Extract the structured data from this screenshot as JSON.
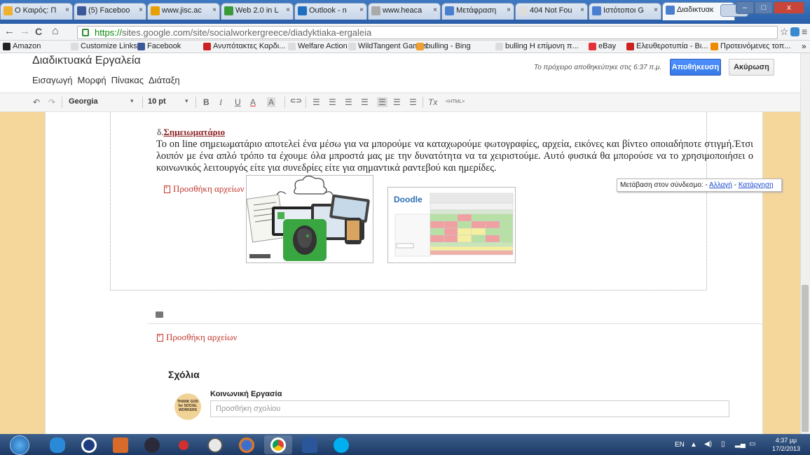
{
  "browser": {
    "tabs": [
      {
        "label": "Ο Καιρός: Π",
        "favicon_color": "#f0b030"
      },
      {
        "label": "(5) Faceboo",
        "favicon_color": "#3b5998"
      },
      {
        "label": "www.jisc.ac",
        "favicon_color": "#e7a000"
      },
      {
        "label": "Web 2.0 in L",
        "favicon_color": "#3a9a3a"
      },
      {
        "label": "Outlook - n",
        "favicon_color": "#1e6fc0"
      },
      {
        "label": "www.heaca",
        "favicon_color": "#aaaaaa"
      },
      {
        "label": "Μετάφραση",
        "favicon_color": "#4a7fd0"
      },
      {
        "label": "404 Not Fou",
        "favicon_color": "#dddddd"
      },
      {
        "label": "Ιστότοποι G",
        "favicon_color": "#4a7fd0"
      },
      {
        "label": "Διαδικτυακ",
        "favicon_color": "#4a7fd0",
        "active": true
      }
    ],
    "tab_close": "×",
    "window_controls": {
      "minimize": "–",
      "maximize": "□",
      "close": "x"
    },
    "url_scheme": "https://",
    "url_rest": "sites.google.com/site/socialworkergreece/diadyktiaka-ergaleia",
    "nav": {
      "back": "←",
      "forward": "→",
      "reload": "C",
      "home": "⌂",
      "star": "☆",
      "menu": "≡"
    },
    "bookmarks": [
      {
        "label": "Amazon",
        "color": "#222222"
      },
      {
        "label": "Customize Links",
        "color": "#dddddd"
      },
      {
        "label": "Facebook",
        "color": "#3b5998"
      },
      {
        "label": "Ανυπότακτες Καρδι...",
        "color": "#cc2222"
      },
      {
        "label": "Welfare Action",
        "color": "#dddddd"
      },
      {
        "label": "WildTangent Games",
        "color": "#dddddd"
      },
      {
        "label": "bulling - Bing",
        "color": "#f0a030"
      },
      {
        "label": "bulling Η επίμονη π...",
        "color": "#dddddd"
      },
      {
        "label": "eBay",
        "color": "#e53238"
      },
      {
        "label": "Ελευθεροτυπία - Βι...",
        "color": "#cc2222"
      },
      {
        "label": "Προτεινόμενες τοπ...",
        "color": "#f08a00"
      }
    ],
    "bookmarks_more": "»"
  },
  "site": {
    "title": "Διαδικτυακά Εργαλεία",
    "menu": [
      "Εισαγωγή",
      "Μορφή",
      "Πίνακας",
      "Διάταξη"
    ],
    "save_note": "Το πρόχειρο αποθηκεύτηκε στις 6:37 π.μ.",
    "save_label": "Αποθήκευση",
    "cancel_label": "Ακύρωση"
  },
  "format_toolbar": {
    "undo": "↶",
    "redo": "↷",
    "font": "Georgia",
    "size": "10 pt",
    "bold": "B",
    "italic": "I",
    "underline": "U",
    "text_color": "A",
    "highlight": "A",
    "link": "⊂⊃",
    "clear": "Tx",
    "html": "<HTML>"
  },
  "content": {
    "heading_prefix": "δ.",
    "heading": "Σημειωματάριο",
    "paragraph": "Το on line σημειωματάριο αποτελεί ένα μέσω για να μπορούμε να καταχωρούμε φωτογραφίες, αρχεία, εικόνες και βίντεο οποιαδήποτε στιγμή.Έτσι λοιπόν με ένα απλό τρόπο τα έχουμε όλα μπροστά μας με την δυνατότητα να τα χειριστούμε. Αυτό φυσικά θα μπορούσε να το χρησιμοποιήσει ο κοινωνικός λειτουργός είτε για συνεδρίες είτε για σημαντικά ραντεβού και  ημερίδες.",
    "attach_label": "Προσθήκη αρχείων",
    "image2_logo": "Doodle",
    "tooltip": {
      "label": "Μετάβαση στον σύνδεσμο:",
      "sep": "-",
      "change": "Αλλαγή",
      "remove": "Κατάργηση"
    }
  },
  "comments": {
    "title": "Σχόλια",
    "author": "Κοινωνική Εργασία",
    "placeholder": "Προσθήκη σχολίου",
    "avatar_text": "THANK GOD for SOCIAL WORKERS"
  },
  "taskbar": {
    "lang": "EN",
    "time": "4:37 μμ",
    "date": "17/2/2013"
  }
}
